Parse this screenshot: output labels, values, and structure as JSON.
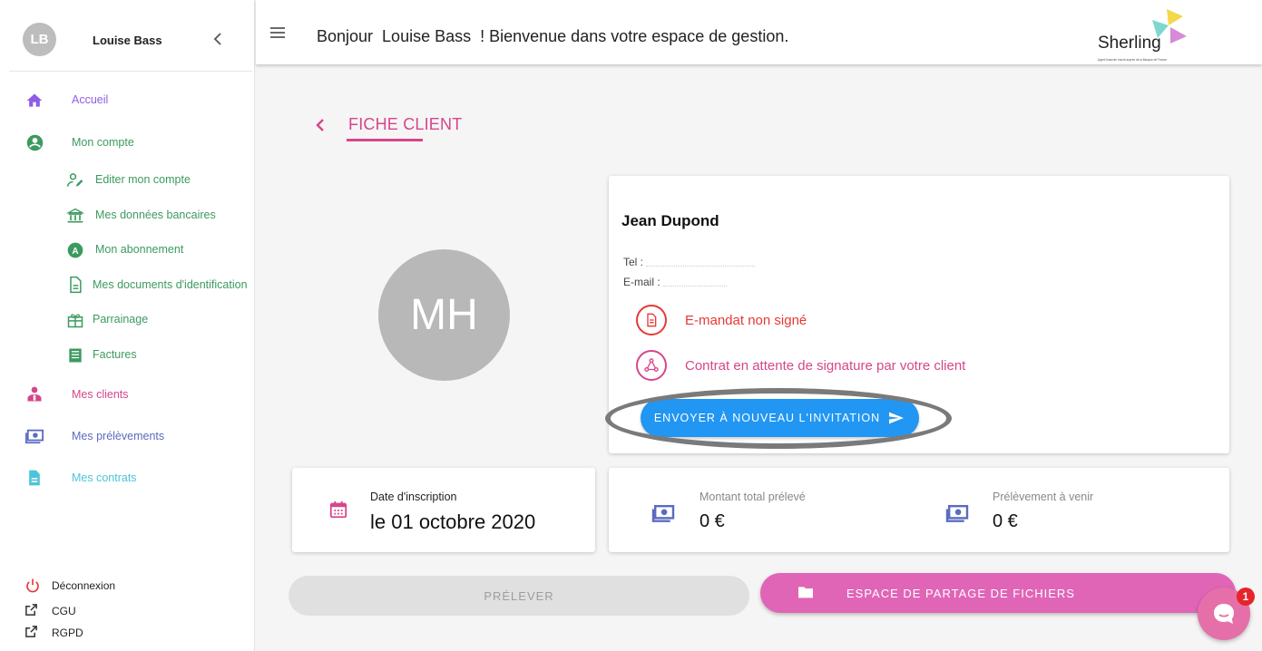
{
  "colors": {
    "accent_pink": "#d6468b",
    "purple": "#8e5ce6",
    "green": "#3c9a5f",
    "blue_grey": "#5b6bbf",
    "cyan": "#4dc4d9",
    "red": "#e53935",
    "primary_blue": "#2196f3"
  },
  "sidebar": {
    "avatar_initials": "LB",
    "user_name": "Louise Bass",
    "items": [
      {
        "label": "Accueil",
        "icon": "home-icon"
      },
      {
        "label": "Mon compte",
        "icon": "account-circle-icon"
      },
      {
        "label": "Editer mon compte",
        "icon": "edit-user-icon"
      },
      {
        "label": "Mes données bancaires",
        "icon": "bank-icon"
      },
      {
        "label": "Mon abonnement",
        "icon": "subscription-badge-icon"
      },
      {
        "label": "Mes documents d'identification",
        "icon": "document-icon"
      },
      {
        "label": "Parrainage",
        "icon": "gift-icon"
      },
      {
        "label": "Factures",
        "icon": "receipt-icon"
      },
      {
        "label": "Mes clients",
        "icon": "clients-icon"
      },
      {
        "label": "Mes prélèvements",
        "icon": "money-icon"
      },
      {
        "label": "Mes contrats",
        "icon": "contract-file-icon"
      }
    ],
    "footer": [
      {
        "label": "Déconnexion",
        "icon": "power-icon"
      },
      {
        "label": "CGU",
        "icon": "external-link-icon"
      },
      {
        "label": "RGPD",
        "icon": "external-link-icon"
      }
    ]
  },
  "topbar": {
    "greeting": "Bonjour  Louise Bass  ! Bienvenue dans votre espace de gestion.",
    "logo_text": "Sherling",
    "logo_tagline": "Agent financier inscrit auprès de la Banque de France"
  },
  "page": {
    "title": "FICHE CLIENT"
  },
  "client": {
    "avatar_initials": "MH",
    "name": "Jean Dupond",
    "tel_label": "Tel : ",
    "email_label": "E-mail : ",
    "status_mandate": "E-mandat non signé",
    "status_contract": "Contrat en attente de signature par votre client",
    "resend_button": "ENVOYER À NOUVEAU L'INVITATION"
  },
  "stats": {
    "date_label": "Date d'inscription",
    "date_value": "le 01 octobre 2020",
    "total_label": "Montant total prélevé",
    "total_value": "0 €",
    "upcoming_label": "Prélèvement à venir",
    "upcoming_value": "0 €"
  },
  "actions": {
    "prelever": "PRÉLEVER",
    "file_sharing": "ESPACE DE PARTAGE DE FICHIERS"
  },
  "chat": {
    "badge_count": "1"
  }
}
